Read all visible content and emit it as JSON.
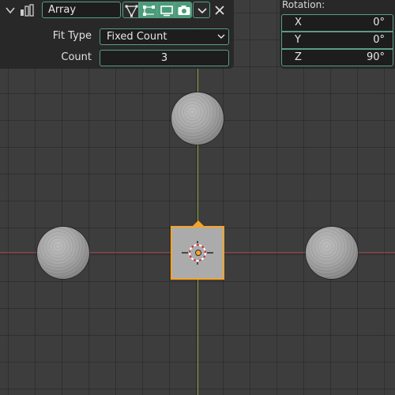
{
  "modifier": {
    "name": "Array",
    "icons": [
      "collapse-chevron-icon",
      "array-modifier-icon",
      "edit-cage-icon",
      "edit-mode-icon",
      "realtime-display-icon",
      "render-camera-icon",
      "dropdown-chevron-icon",
      "close-icon"
    ],
    "toggles": {
      "edit_cage": false,
      "edit_mode": true,
      "realtime": true,
      "render": true
    }
  },
  "settings": {
    "fit_type_label": "Fit Type",
    "fit_type_value": "Fixed Count",
    "count_label": "Count",
    "count_value": "3"
  },
  "rotation": {
    "title": "Rotation:",
    "x_label": "X",
    "x_value": "0°",
    "y_label": "Y",
    "y_value": "0°",
    "z_label": "Z",
    "z_value": "90°"
  },
  "colors": {
    "accent": "#5b9c85",
    "active_toggle": "#4a9c79",
    "selection": "#f5a42a",
    "x_axis": "#a2404a",
    "y_axis": "#8aa136",
    "viewport_bg": "#3d3d3d"
  }
}
